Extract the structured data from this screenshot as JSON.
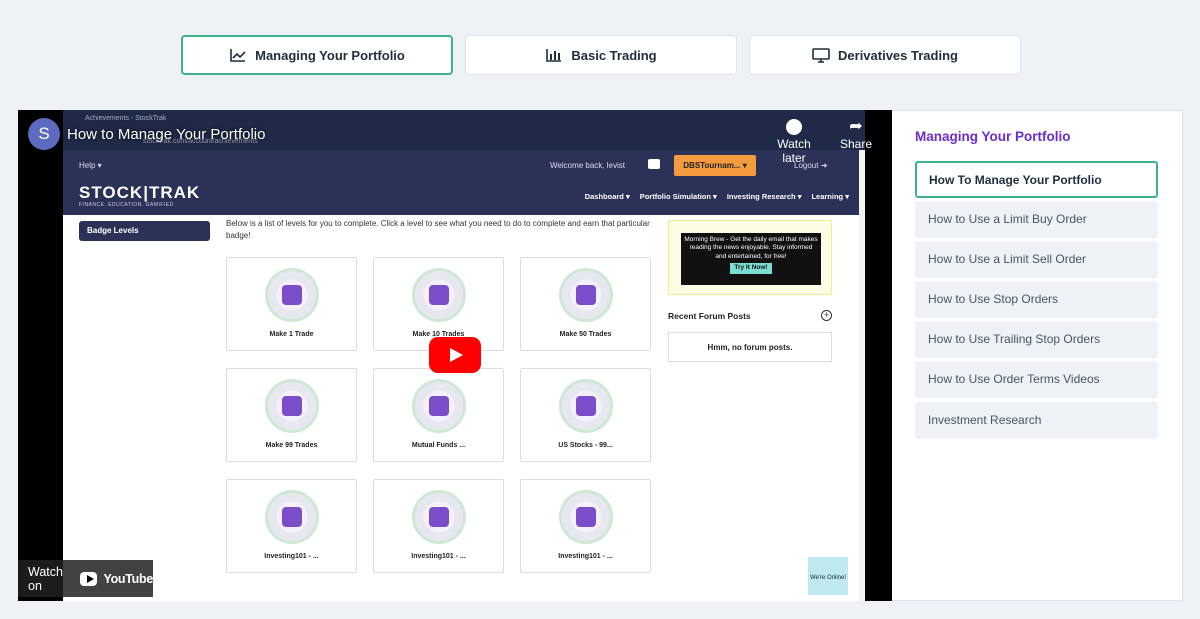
{
  "tabs": [
    {
      "label": "Managing Your Portfolio",
      "icon": "line-chart-icon"
    },
    {
      "label": "Basic Trading",
      "icon": "bar-chart-icon"
    },
    {
      "label": "Derivatives Trading",
      "icon": "monitor-icon"
    }
  ],
  "video": {
    "channel_initial": "S",
    "title": "How to Manage Your Portfolio",
    "watch_later": "Watch later",
    "share": "Share",
    "watch_on": "Watch on",
    "youtube": "YouTube",
    "screen": {
      "browser_tab": "Achievements - StockTrak",
      "url": "stocktrak.com/account/achievements",
      "help": "Help ▾",
      "welcome": "Welcome back, levist",
      "tournament": "DBSTournam... ▾",
      "logout": "Logout ➜",
      "logo": "STOCK|TRAK",
      "logo_sub": "FINANCE. EDUCATION. GAMIFIED",
      "nav": [
        "Dashboard ▾",
        "Portfolio Simulation ▾",
        "Investing Research ▾",
        "Learning ▾"
      ],
      "badge_levels": "Badge Levels",
      "intro": "Below is a list of levels for you to complete. Click a level to see what you need to do to complete and earn that particular badge!",
      "badges": [
        "Make 1 Trade",
        "Make 10 Trades",
        "Make 50 Trades",
        "Make 99 Trades",
        "Mutual Funds ...",
        "US Stocks - 99...",
        "Investing101 - ...",
        "Investing101 - ...",
        "Investing101 - ..."
      ],
      "promo": "Morning Brew - Get the daily email that makes reading the news enjoyable. Stay informed and entertained, for free!",
      "promo_cta": "Try It Now!",
      "forum_title": "Recent Forum Posts",
      "forum_empty": "Hmm, no forum posts.",
      "online": "We're Online!"
    }
  },
  "sidebar": {
    "title": "Managing Your Portfolio",
    "items": [
      "How To Manage Your Portfolio",
      "How to Use a Limit Buy Order",
      "How to Use a Limit Sell Order",
      "How to Use Stop Orders",
      "How to Use Trailing Stop Orders",
      "How to Use Order Terms Videos",
      "Investment Research"
    ]
  },
  "colors": {
    "accent_green": "#3fb28a",
    "title_purple": "#6a2ecb",
    "yt_red": "#ff0000"
  }
}
